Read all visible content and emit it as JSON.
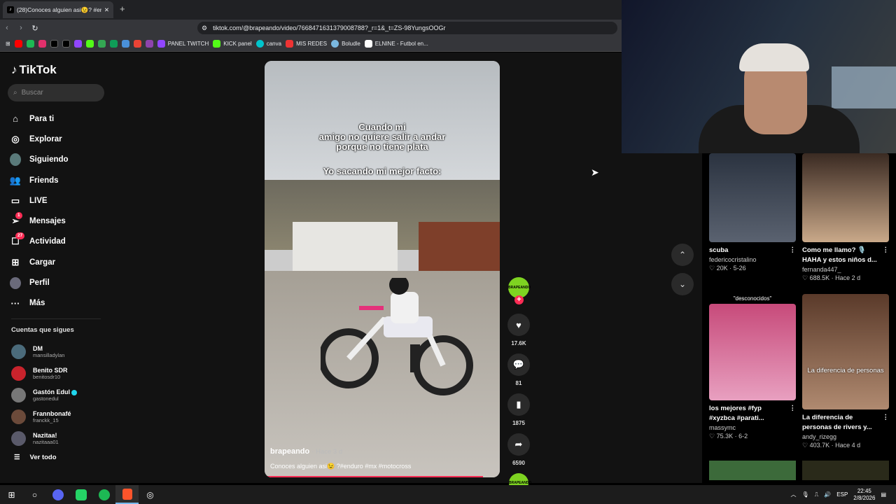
{
  "browser": {
    "tab_title": "(28)Conoces alguien asi😉? #en",
    "url": "tiktok.com/@brapeando/video/7668471631379008788?_r=1&_t=ZS-98YungsOOGr",
    "bookmarks": [
      "PANEL TWITCH",
      "KICK panel",
      "canva",
      "MIS REDES",
      "Boludle",
      "ELNINE - Futbol en..."
    ]
  },
  "sidebar": {
    "logo": "TikTok",
    "search_placeholder": "Buscar",
    "nav": [
      {
        "label": "Para ti",
        "icon": "home-icon"
      },
      {
        "label": "Explorar",
        "icon": "compass-icon"
      },
      {
        "label": "Siguiendo",
        "icon": "following-icon"
      },
      {
        "label": "Friends",
        "icon": "friends-icon"
      },
      {
        "label": "LIVE",
        "icon": "live-icon"
      },
      {
        "label": "Mensajes",
        "icon": "messages-icon",
        "badge": "1"
      },
      {
        "label": "Actividad",
        "icon": "activity-icon",
        "badge": "27"
      },
      {
        "label": "Cargar",
        "icon": "upload-icon"
      },
      {
        "label": "Perfil",
        "icon": "profile-icon"
      },
      {
        "label": "Más",
        "icon": "more-icon"
      }
    ],
    "following_title": "Cuentas que sigues",
    "following": [
      {
        "name": "DM",
        "handle": "mansilladylan"
      },
      {
        "name": "Benito SDR",
        "handle": "benitosdr10"
      },
      {
        "name": "Gastón Edul",
        "handle": "gastonedul",
        "verified": true
      },
      {
        "name": "Frannbonafé",
        "handle": "franckk_15"
      },
      {
        "name": "Nazitaa!",
        "handle": "nazitaaa01"
      }
    ],
    "see_all": "Ver todo"
  },
  "video": {
    "caption_1": "Cuando mi\namigo no quiere salir a andar\nporque no tiene plata",
    "caption_2": "Yo sacando mi mejor facto:",
    "author": "brapeando",
    "time": "· Hace 3 d",
    "description": "Conoces alguien asi😉 ?#enduro #mx #motocross",
    "avatar_text": "BRAPEANDO",
    "likes": "17.6K",
    "comments": "81",
    "saves": "1875",
    "shares": "6590"
  },
  "recommendations": [
    {
      "title": "scuba",
      "user": "federicocristalino",
      "stats": "♡ 20K · 5-26"
    },
    {
      "title": "Como me llamo? 🎙️\nHAHA y estos niños d...",
      "user": "fernanda447_",
      "stats": "♡ 688.5K · Hace 2 d"
    },
    {
      "title": "los mejores #fyp\n#xyzbca #parati...",
      "user": "massymc",
      "stats": "♡ 75.3K · 6-2",
      "overlay": "\"desconocidos\""
    },
    {
      "title": "La diferencia de\npersonas de rivers y...",
      "user": "andy_rizegg",
      "stats": "♡ 403.7K · Hace 4 d",
      "overlay": "La diferencia de personas"
    }
  ],
  "taskbar": {
    "lang": "ESP",
    "time": "22:45",
    "date": "2/8/2026"
  },
  "colors": {
    "accent": "#fe2c55",
    "brand_green": "#7ed321"
  }
}
